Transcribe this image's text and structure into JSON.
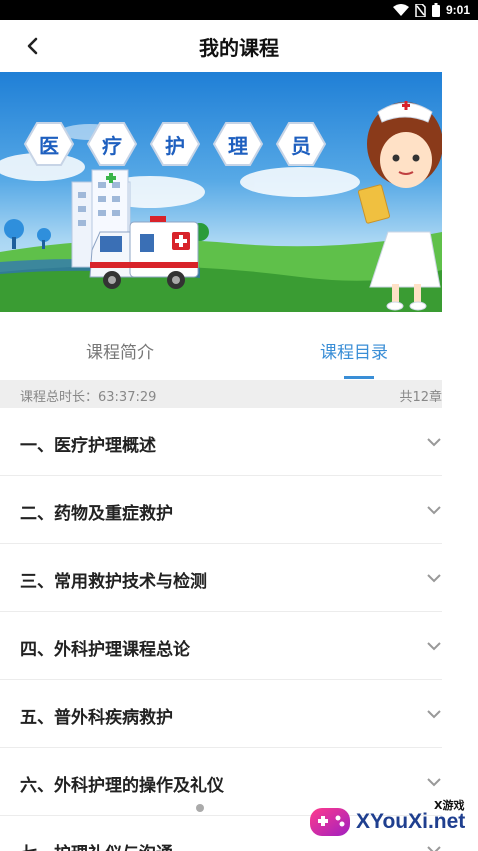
{
  "status_bar": {
    "time": "9:01",
    "icons": [
      "wifi-icon",
      "no-sim-icon",
      "battery-icon"
    ]
  },
  "header": {
    "title": "我的课程",
    "back_icon": "back-arrow-icon"
  },
  "banner": {
    "title_chars": [
      "医",
      "疗",
      "护",
      "理",
      "员"
    ],
    "illustration": [
      "ambulance",
      "hospital-building",
      "nurse",
      "trees"
    ]
  },
  "tabs": [
    {
      "label": "课程简介",
      "active": false
    },
    {
      "label": "课程目录",
      "active": true
    }
  ],
  "summary": {
    "duration": "课程总时长：63:37:29",
    "chapter_count": "共12章"
  },
  "chapters": [
    {
      "title": "一、医疗护理概述"
    },
    {
      "title": "二、药物及重症救护"
    },
    {
      "title": "三、常用救护技术与检测"
    },
    {
      "title": "四、外科护理课程总论"
    },
    {
      "title": "五、普外科疾病救护"
    },
    {
      "title": "六、外科护理的操作及礼仪"
    },
    {
      "title": "七、护理礼仪与沟通"
    }
  ],
  "watermark": {
    "small": "X游戏",
    "big": "XYouXi.net"
  },
  "colors": {
    "accent": "#3a8ed6",
    "hex_text": "#1e5fbf",
    "summary_bg": "#eeeeee"
  }
}
